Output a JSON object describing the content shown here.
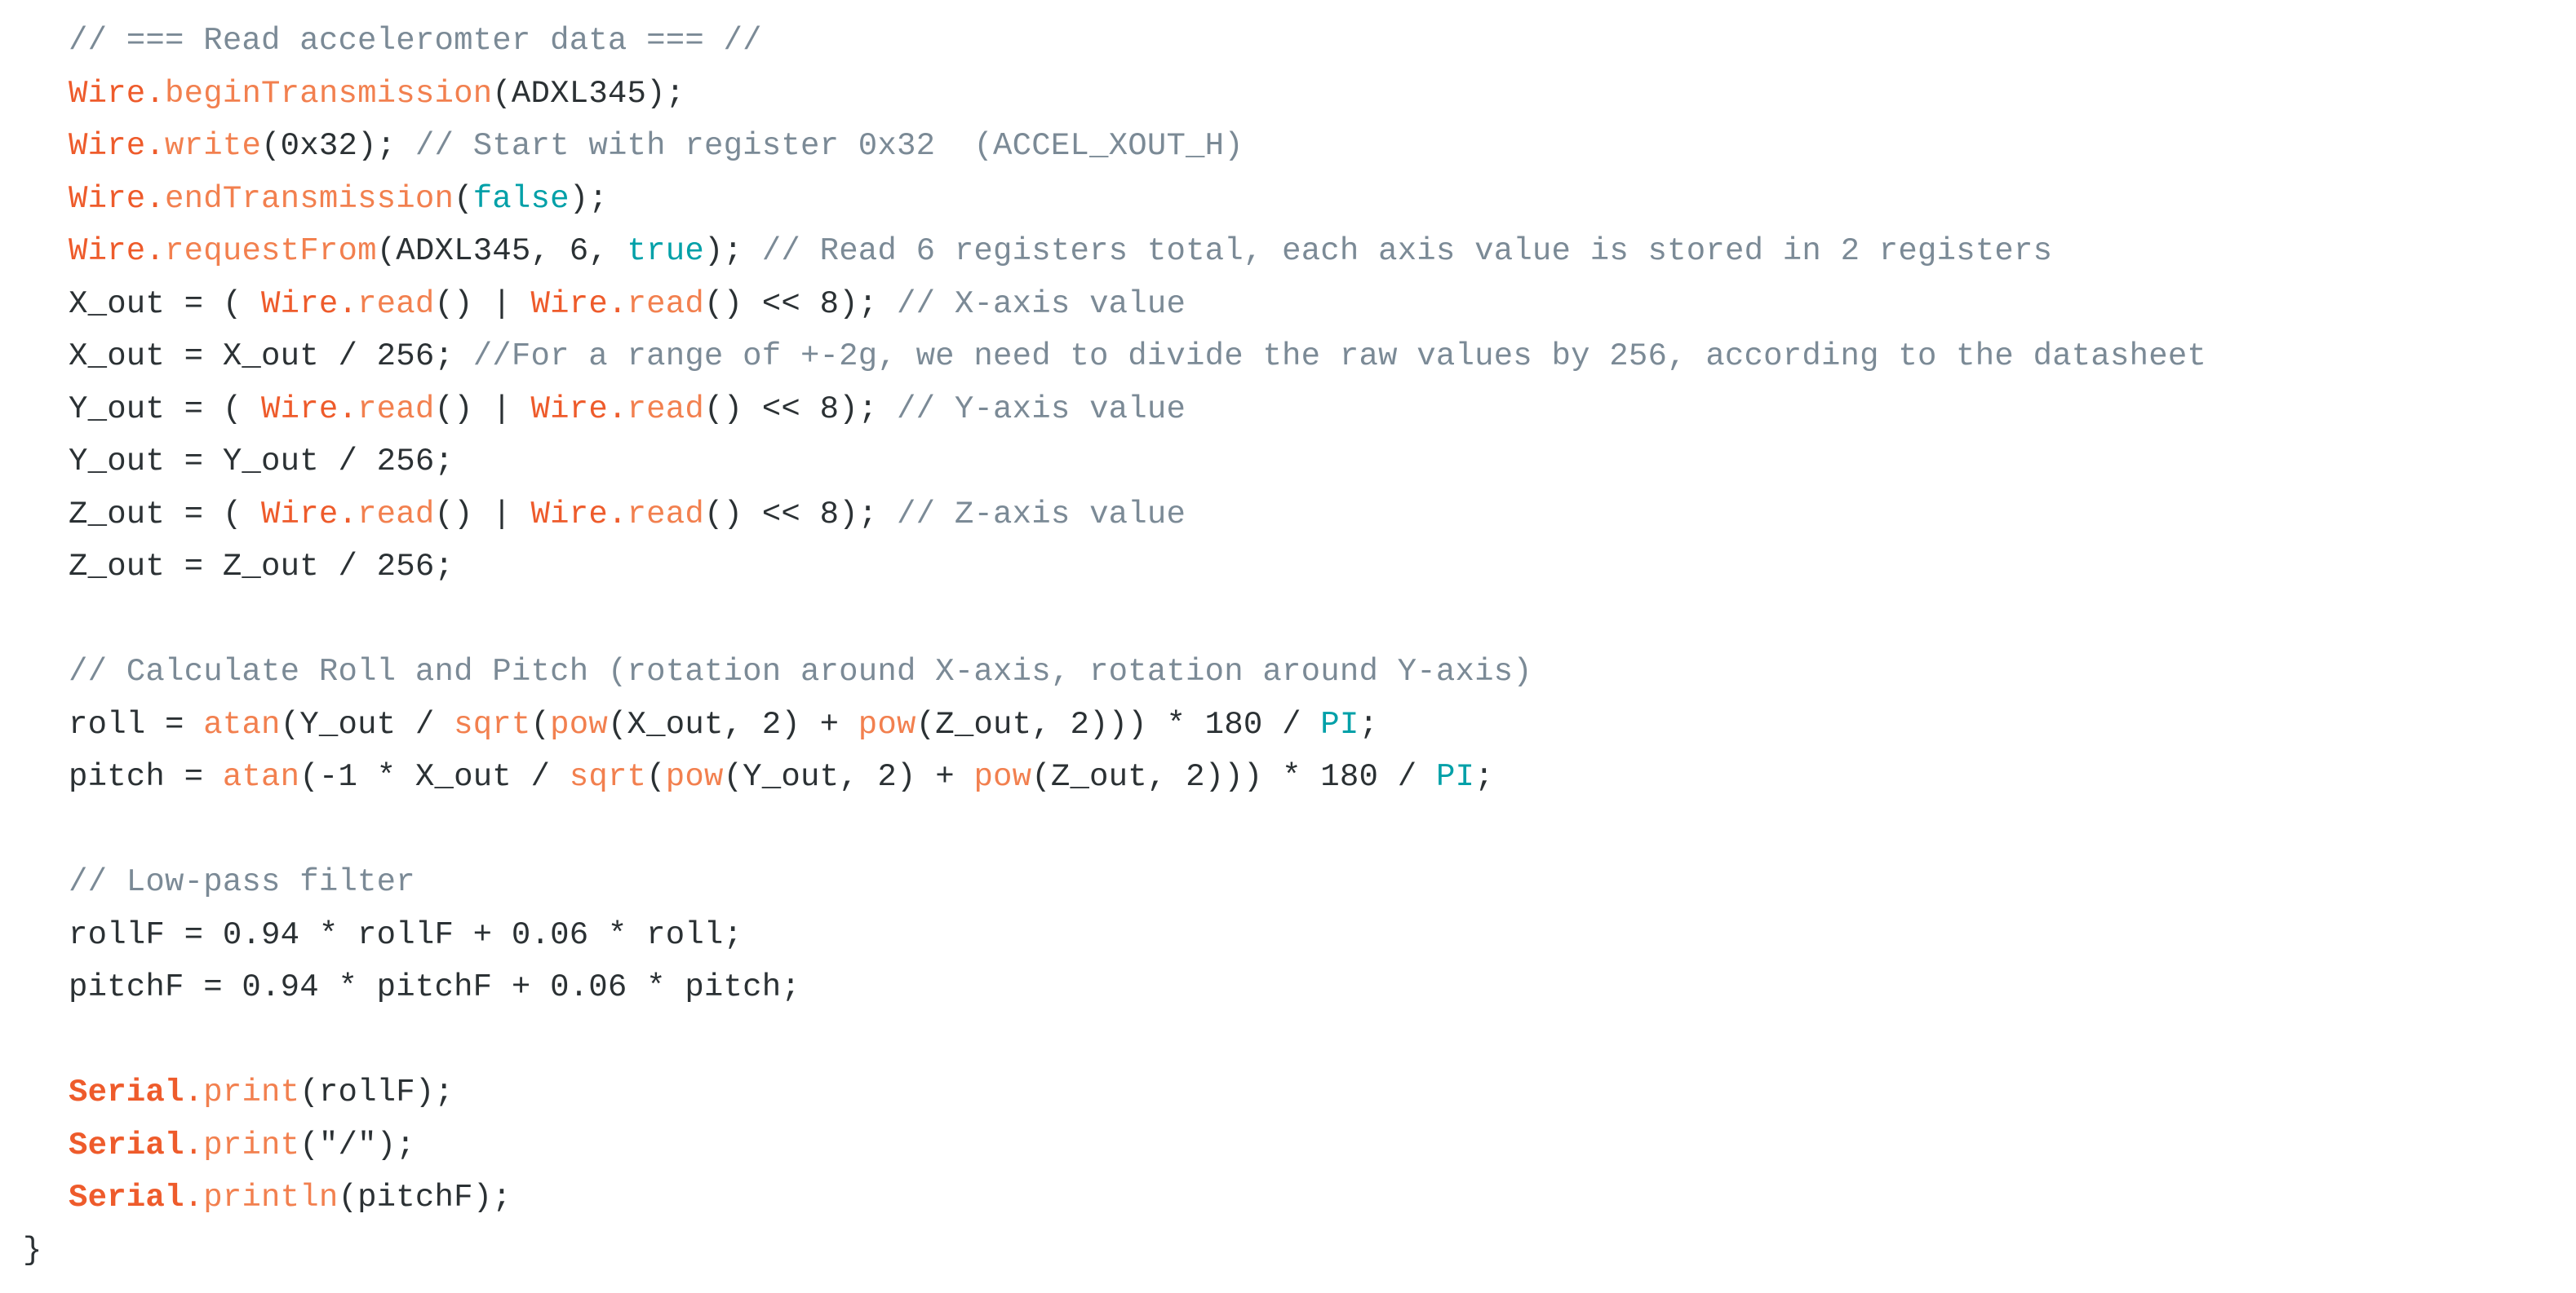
{
  "editor": {
    "background_color": "#ffffff",
    "language": "arduino-cpp",
    "palette": {
      "comment": "#7b8a96",
      "object": "#ee5b2b",
      "method": "#f2804f",
      "keyword": "#00a0a8",
      "plain": "#2b3134",
      "string": "#2b3134"
    }
  },
  "code": {
    "lines": [
      {
        "id": "line-1",
        "indent": "normal",
        "tokens": [
          {
            "t": "// === Read acceleromter data === //",
            "k": "comment"
          }
        ]
      },
      {
        "id": "line-2",
        "indent": "normal",
        "tokens": [
          {
            "t": "Wire",
            "k": "object"
          },
          {
            "t": ".",
            "k": "object"
          },
          {
            "t": "beginTransmission",
            "k": "method"
          },
          {
            "t": "(ADXL345);",
            "k": "plain"
          }
        ]
      },
      {
        "id": "line-3",
        "indent": "normal",
        "tokens": [
          {
            "t": "Wire",
            "k": "object"
          },
          {
            "t": ".",
            "k": "object"
          },
          {
            "t": "write",
            "k": "method"
          },
          {
            "t": "(0x32); ",
            "k": "plain"
          },
          {
            "t": "// Start with register 0x32  (ACCEL_XOUT_H)",
            "k": "comment"
          }
        ]
      },
      {
        "id": "line-4",
        "indent": "normal",
        "tokens": [
          {
            "t": "Wire",
            "k": "object"
          },
          {
            "t": ".",
            "k": "object"
          },
          {
            "t": "endTransmission",
            "k": "method"
          },
          {
            "t": "(",
            "k": "plain"
          },
          {
            "t": "false",
            "k": "keyword"
          },
          {
            "t": ");",
            "k": "plain"
          }
        ]
      },
      {
        "id": "line-5",
        "indent": "normal",
        "tokens": [
          {
            "t": "Wire",
            "k": "object"
          },
          {
            "t": ".",
            "k": "object"
          },
          {
            "t": "requestFrom",
            "k": "method"
          },
          {
            "t": "(ADXL345, 6, ",
            "k": "plain"
          },
          {
            "t": "true",
            "k": "keyword"
          },
          {
            "t": "); ",
            "k": "plain"
          },
          {
            "t": "// Read 6 registers total, each axis value is stored in 2 registers",
            "k": "comment"
          }
        ]
      },
      {
        "id": "line-6",
        "indent": "normal",
        "tokens": [
          {
            "t": "X_out = ( ",
            "k": "plain"
          },
          {
            "t": "Wire",
            "k": "object"
          },
          {
            "t": ".",
            "k": "object"
          },
          {
            "t": "read",
            "k": "method"
          },
          {
            "t": "() | ",
            "k": "plain"
          },
          {
            "t": "Wire",
            "k": "object"
          },
          {
            "t": ".",
            "k": "object"
          },
          {
            "t": "read",
            "k": "method"
          },
          {
            "t": "() << 8); ",
            "k": "plain"
          },
          {
            "t": "// X-axis value",
            "k": "comment"
          }
        ]
      },
      {
        "id": "line-7",
        "indent": "normal",
        "tokens": [
          {
            "t": "X_out = X_out / 256; ",
            "k": "plain"
          },
          {
            "t": "//For a range of +-2g, we need to divide the raw values by 256, according to the datasheet",
            "k": "comment"
          }
        ]
      },
      {
        "id": "line-8",
        "indent": "normal",
        "tokens": [
          {
            "t": "Y_out = ( ",
            "k": "plain"
          },
          {
            "t": "Wire",
            "k": "object"
          },
          {
            "t": ".",
            "k": "object"
          },
          {
            "t": "read",
            "k": "method"
          },
          {
            "t": "() | ",
            "k": "plain"
          },
          {
            "t": "Wire",
            "k": "object"
          },
          {
            "t": ".",
            "k": "object"
          },
          {
            "t": "read",
            "k": "method"
          },
          {
            "t": "() << 8); ",
            "k": "plain"
          },
          {
            "t": "// Y-axis value",
            "k": "comment"
          }
        ]
      },
      {
        "id": "line-9",
        "indent": "normal",
        "tokens": [
          {
            "t": "Y_out = Y_out / 256;",
            "k": "plain"
          }
        ]
      },
      {
        "id": "line-10",
        "indent": "normal",
        "tokens": [
          {
            "t": "Z_out = ( ",
            "k": "plain"
          },
          {
            "t": "Wire",
            "k": "object"
          },
          {
            "t": ".",
            "k": "object"
          },
          {
            "t": "read",
            "k": "method"
          },
          {
            "t": "() | ",
            "k": "plain"
          },
          {
            "t": "Wire",
            "k": "object"
          },
          {
            "t": ".",
            "k": "object"
          },
          {
            "t": "read",
            "k": "method"
          },
          {
            "t": "() << 8); ",
            "k": "plain"
          },
          {
            "t": "// Z-axis value",
            "k": "comment"
          }
        ]
      },
      {
        "id": "line-11",
        "indent": "normal",
        "tokens": [
          {
            "t": "Z_out = Z_out / 256;",
            "k": "plain"
          }
        ]
      },
      {
        "id": "line-12",
        "indent": "normal",
        "blank": true,
        "tokens": []
      },
      {
        "id": "line-13",
        "indent": "normal",
        "tokens": [
          {
            "t": "// Calculate Roll and Pitch (rotation around X-axis, rotation around Y-axis)",
            "k": "comment"
          }
        ]
      },
      {
        "id": "line-14",
        "indent": "normal",
        "tokens": [
          {
            "t": "roll = ",
            "k": "plain"
          },
          {
            "t": "atan",
            "k": "method"
          },
          {
            "t": "(Y_out / ",
            "k": "plain"
          },
          {
            "t": "sqrt",
            "k": "method"
          },
          {
            "t": "(",
            "k": "plain"
          },
          {
            "t": "pow",
            "k": "method"
          },
          {
            "t": "(X_out, 2) + ",
            "k": "plain"
          },
          {
            "t": "pow",
            "k": "method"
          },
          {
            "t": "(Z_out, 2))) * 180 / ",
            "k": "plain"
          },
          {
            "t": "PI",
            "k": "keyword"
          },
          {
            "t": ";",
            "k": "plain"
          }
        ]
      },
      {
        "id": "line-15",
        "indent": "normal",
        "tokens": [
          {
            "t": "pitch = ",
            "k": "plain"
          },
          {
            "t": "atan",
            "k": "method"
          },
          {
            "t": "(-1 * X_out / ",
            "k": "plain"
          },
          {
            "t": "sqrt",
            "k": "method"
          },
          {
            "t": "(",
            "k": "plain"
          },
          {
            "t": "pow",
            "k": "method"
          },
          {
            "t": "(Y_out, 2) + ",
            "k": "plain"
          },
          {
            "t": "pow",
            "k": "method"
          },
          {
            "t": "(Z_out, 2))) * 180 / ",
            "k": "plain"
          },
          {
            "t": "PI",
            "k": "keyword"
          },
          {
            "t": ";",
            "k": "plain"
          }
        ]
      },
      {
        "id": "line-16",
        "indent": "normal",
        "blank": true,
        "tokens": []
      },
      {
        "id": "line-17",
        "indent": "normal",
        "tokens": [
          {
            "t": "// Low-pass filter",
            "k": "comment"
          }
        ]
      },
      {
        "id": "line-18",
        "indent": "normal",
        "tokens": [
          {
            "t": "rollF = 0.94 * rollF + 0.06 * roll;",
            "k": "plain"
          }
        ]
      },
      {
        "id": "line-19",
        "indent": "normal",
        "tokens": [
          {
            "t": "pitchF = 0.94 * pitchF + 0.06 * pitch;",
            "k": "plain"
          }
        ]
      },
      {
        "id": "line-20",
        "indent": "normal",
        "blank": true,
        "tokens": []
      },
      {
        "id": "line-21",
        "indent": "normal",
        "tokens": [
          {
            "t": "Serial",
            "k": "object-bold"
          },
          {
            "t": ".",
            "k": "object"
          },
          {
            "t": "print",
            "k": "method"
          },
          {
            "t": "(rollF);",
            "k": "plain"
          }
        ]
      },
      {
        "id": "line-22",
        "indent": "normal",
        "tokens": [
          {
            "t": "Serial",
            "k": "object-bold"
          },
          {
            "t": ".",
            "k": "object"
          },
          {
            "t": "print",
            "k": "method"
          },
          {
            "t": "(",
            "k": "plain"
          },
          {
            "t": "\"/\"",
            "k": "string"
          },
          {
            "t": ");",
            "k": "plain"
          }
        ]
      },
      {
        "id": "line-23",
        "indent": "normal",
        "tokens": [
          {
            "t": "Serial",
            "k": "object-bold"
          },
          {
            "t": ".",
            "k": "object"
          },
          {
            "t": "println",
            "k": "method"
          },
          {
            "t": "(pitchF);",
            "k": "plain"
          }
        ]
      },
      {
        "id": "line-24",
        "indent": "outdent",
        "tokens": [
          {
            "t": "}",
            "k": "plain"
          }
        ]
      }
    ]
  }
}
